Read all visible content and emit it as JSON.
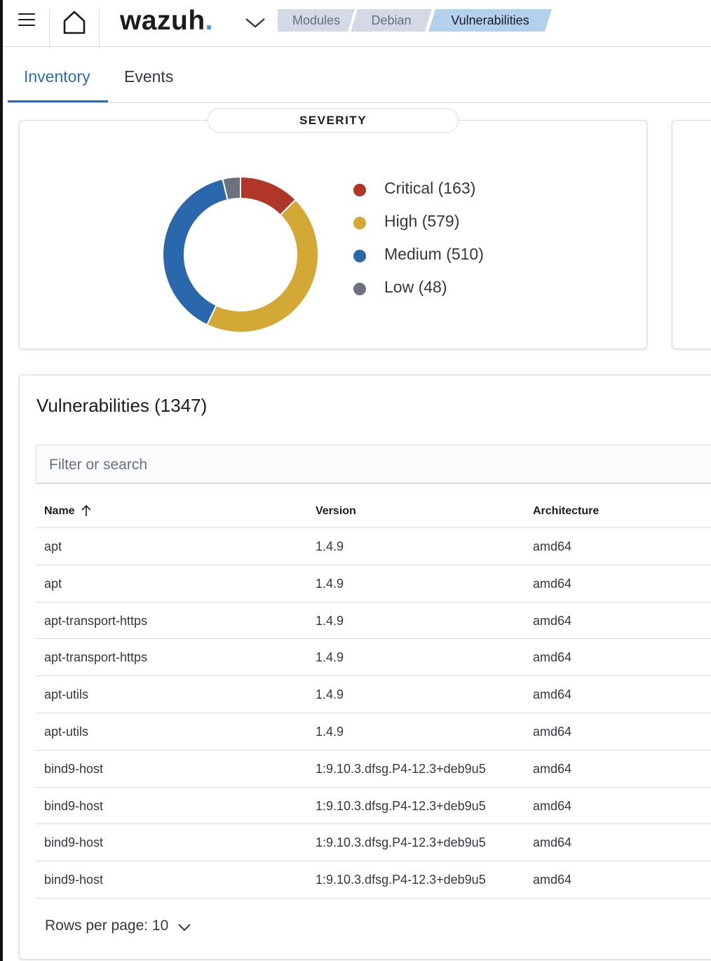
{
  "header": {
    "logo_text": "wazuh",
    "logo_dot": ".",
    "breadcrumbs": [
      "Modules",
      "Debian",
      "Vulnerabilities"
    ]
  },
  "tabs": [
    {
      "label": "Inventory",
      "active": true
    },
    {
      "label": "Events",
      "active": false
    }
  ],
  "severity": {
    "title": "SEVERITY",
    "items": [
      {
        "label": "Critical (163)",
        "count": 163,
        "color": "#b0362a"
      },
      {
        "label": "High (579)",
        "count": 579,
        "color": "#d3a835"
      },
      {
        "label": "Medium (510)",
        "count": 510,
        "color": "#2b67ad"
      },
      {
        "label": "Low (48)",
        "count": 48,
        "color": "#6c717d"
      }
    ]
  },
  "vulnerabilities": {
    "title": "Vulnerabilities (1347)",
    "search_placeholder": "Filter or search",
    "columns": [
      "Name",
      "Version",
      "Architecture"
    ],
    "rows": [
      [
        "apt",
        "1.4.9",
        "amd64"
      ],
      [
        "apt",
        "1.4.9",
        "amd64"
      ],
      [
        "apt-transport-https",
        "1.4.9",
        "amd64"
      ],
      [
        "apt-transport-https",
        "1.4.9",
        "amd64"
      ],
      [
        "apt-utils",
        "1.4.9",
        "amd64"
      ],
      [
        "apt-utils",
        "1.4.9",
        "amd64"
      ],
      [
        "bind9-host",
        "1:9.10.3.dfsg.P4-12.3+deb9u5",
        "amd64"
      ],
      [
        "bind9-host",
        "1:9.10.3.dfsg.P4-12.3+deb9u5",
        "amd64"
      ],
      [
        "bind9-host",
        "1:9.10.3.dfsg.P4-12.3+deb9u5",
        "amd64"
      ],
      [
        "bind9-host",
        "1:9.10.3.dfsg.P4-12.3+deb9u5",
        "amd64"
      ]
    ],
    "rows_per_page_label": "Rows per page: 10"
  },
  "icons": {
    "menu": "hamburger-menu-icon",
    "home": "home-icon",
    "dropdown": "chevron-down-icon",
    "sort": "arrow-up-icon"
  }
}
